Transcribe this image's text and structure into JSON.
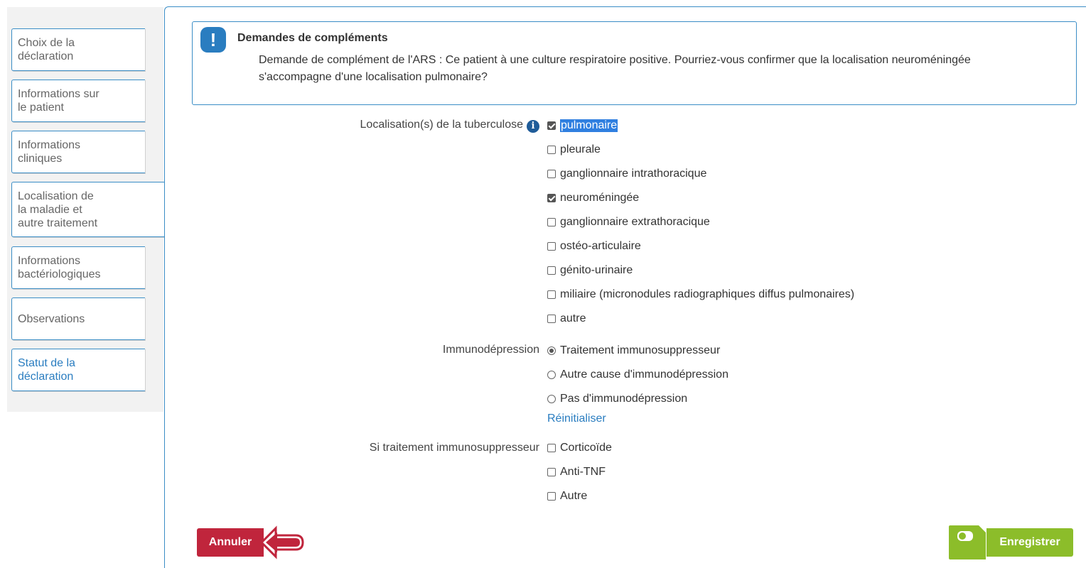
{
  "sidebar": {
    "items": [
      {
        "label_lines": [
          "Choix de la",
          "déclaration"
        ]
      },
      {
        "label_lines": [
          "Informations sur",
          "le patient"
        ]
      },
      {
        "label_lines": [
          "Informations",
          "cliniques"
        ]
      },
      {
        "label_lines": [
          "Localisation de",
          "la maladie et",
          "autre traitement"
        ]
      },
      {
        "label_lines": [
          "Informations",
          "bactériologiques"
        ]
      },
      {
        "label_lines": [
          "Observations"
        ]
      },
      {
        "label_lines": [
          "Statut de la",
          "déclaration"
        ]
      }
    ]
  },
  "alert": {
    "icon": "!",
    "title": "Demandes de compléments",
    "text": "Demande de complément de l'ARS : Ce patient à une culture respiratoire positive. Pourriez-vous confirmer que la localisation neuroméningée s'accompagne d'une localisation pulmonaire?"
  },
  "localisation": {
    "label": "Localisation(s) de la tuberculose",
    "info_icon": "i",
    "options": [
      {
        "label": "pulmonaire",
        "checked": true
      },
      {
        "label": "pleurale",
        "checked": false
      },
      {
        "label": "ganglionnaire intrathoracique",
        "checked": false
      },
      {
        "label": "neuroméningée",
        "checked": true
      },
      {
        "label": "ganglionnaire extrathoracique",
        "checked": false
      },
      {
        "label": "ostéo-articulaire",
        "checked": false
      },
      {
        "label": "génito-urinaire",
        "checked": false
      },
      {
        "label": "miliaire (micronodules radiographiques diffus pulmonaires)",
        "checked": false
      },
      {
        "label": "autre",
        "checked": false
      }
    ]
  },
  "immunodepression": {
    "label": "Immunodépression",
    "options": [
      {
        "label": "Traitement immunosuppresseur",
        "selected": true
      },
      {
        "label": "Autre cause d'immunodépression",
        "selected": false
      },
      {
        "label": "Pas d'immunodépression",
        "selected": false
      }
    ],
    "reset_label": "Réinitialiser"
  },
  "traitement": {
    "label": "Si traitement immunosuppresseur",
    "options": [
      {
        "label": "Corticoïde",
        "checked": false
      },
      {
        "label": "Anti-TNF",
        "checked": false
      },
      {
        "label": "Autre",
        "checked": false
      }
    ]
  },
  "buttons": {
    "cancel_label": "Annuler",
    "save_label": "Enregistrer"
  },
  "colors": {
    "accent": "#3a8dc6",
    "cancel": "#c0253c",
    "save": "#8cbd2a"
  }
}
